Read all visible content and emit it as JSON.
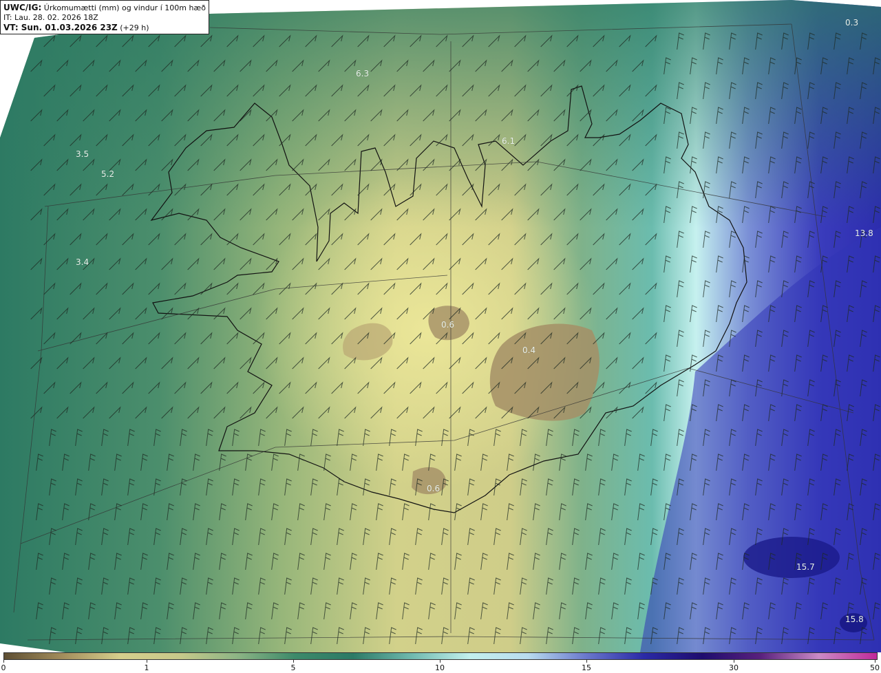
{
  "header": {
    "model": "UWC/IG:",
    "product": "Úrkomumætti (mm) og vindur í 100m hæð",
    "init_time": "IT: Lau. 28. 02. 2026 18Z",
    "valid_label": "VT: Sun. 01.03.2026 23Z",
    "lead": "(+29 h)"
  },
  "map_values": [
    "6.3",
    "6.1",
    "3.5",
    "5.2",
    "3.4",
    "0.6",
    "0.4",
    "0.6",
    "13.8",
    "15.7",
    "15.8",
    "0.3"
  ],
  "colorbar": {
    "ticks": [
      "0",
      "1",
      "5",
      "10",
      "15",
      "30",
      "50"
    ],
    "colors": [
      "#5e4f33",
      "#a38d5c",
      "#d6cf8c",
      "#c8c98a",
      "#8db585",
      "#3d8a6a",
      "#2c7a66",
      "#6fb9ae",
      "#c3f0ee",
      "#b9dcef",
      "#6a78cc",
      "#2a2aa6",
      "#1e0c6e",
      "#59207d",
      "#c98ac6",
      "#c02a9a"
    ]
  },
  "colors": {
    "sea_west": "#2f7f66",
    "land_low": "#c9c77f",
    "highland": "#ece898",
    "glacier": "#9e8b63",
    "east_light": "#c7f1ef",
    "east_deep": "#2c2eb2",
    "coastline": "#111111"
  }
}
